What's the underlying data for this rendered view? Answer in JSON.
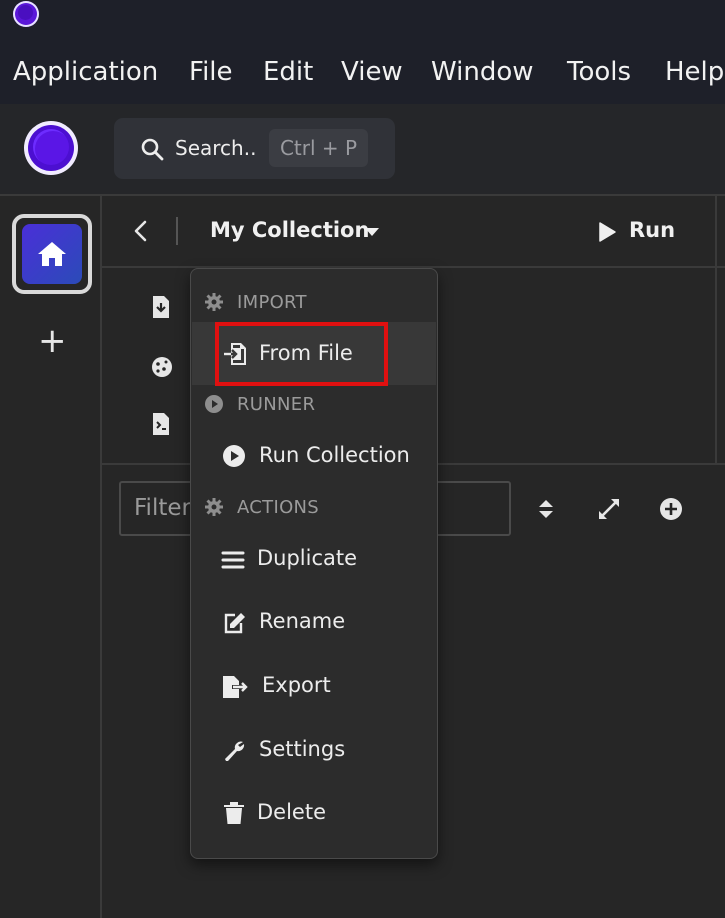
{
  "menubar": {
    "items": [
      "Application",
      "File",
      "Edit",
      "View",
      "Window",
      "Tools",
      "Help"
    ]
  },
  "search": {
    "placeholder": "Search..",
    "shortcut": "Ctrl + P"
  },
  "collection": {
    "title": "My Collection",
    "run_label": "Run"
  },
  "filter": {
    "placeholder": "Filter"
  },
  "dropdown": {
    "import_section": "IMPORT",
    "from_file": "From File",
    "runner_section": "RUNNER",
    "run_collection": "Run Collection",
    "actions_section": "ACTIONS",
    "duplicate": "Duplicate",
    "rename": "Rename",
    "export": "Export",
    "settings": "Settings",
    "delete": "Delete"
  },
  "colors": {
    "accent": "#5b17d9",
    "highlight": "#e01010",
    "background": "#262626"
  }
}
